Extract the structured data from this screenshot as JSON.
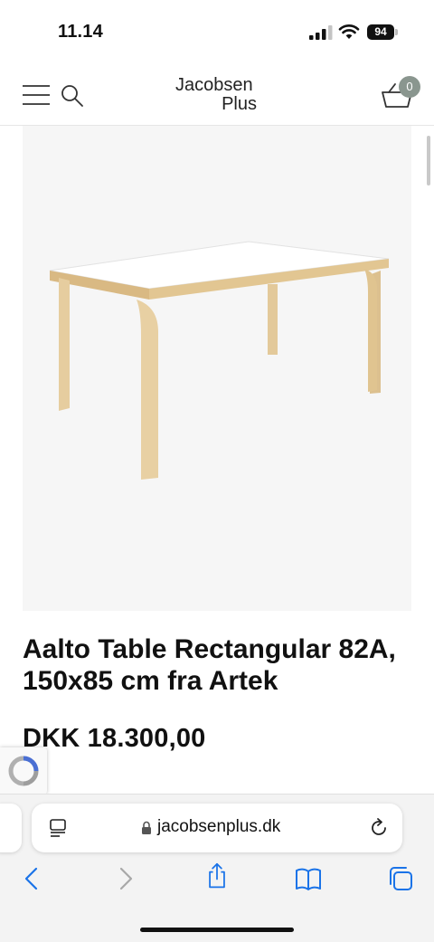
{
  "status_bar": {
    "time": "11.14",
    "battery": "94"
  },
  "header": {
    "logo_line1": "Jacobsen",
    "logo_line2": "Plus",
    "cart_count": "0",
    "icons": [
      "menu-icon",
      "search-icon",
      "basket-icon"
    ]
  },
  "product": {
    "title": "Aalto Table Rectangular 82A, 150x85 cm fra Artek",
    "price": "DKK 18.300,00"
  },
  "browser": {
    "url": "jacobsenplus.dk",
    "icons": [
      "reader-icon",
      "lock-icon",
      "reload-icon",
      "back-icon",
      "forward-icon",
      "share-icon",
      "bookmarks-icon",
      "tabs-icon"
    ]
  },
  "colors": {
    "accent_badge": "#8a968f",
    "ios_blue": "#1a73e8",
    "wood": "#e3c99a",
    "image_bg": "#f6f6f6"
  }
}
